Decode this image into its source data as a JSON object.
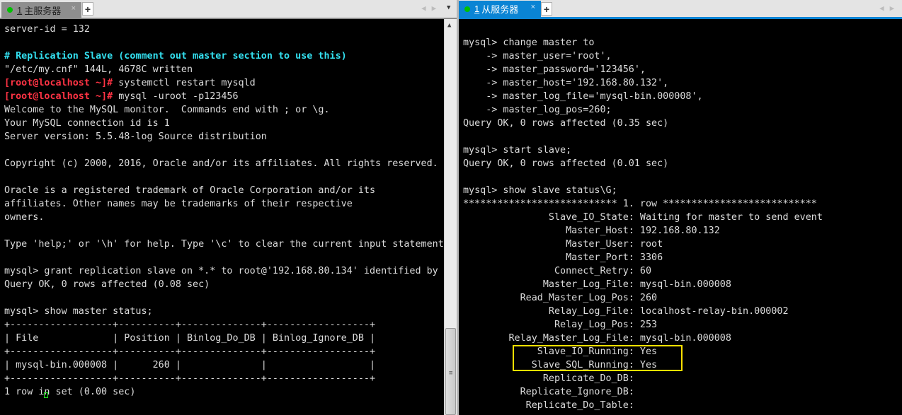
{
  "left": {
    "tab": {
      "number": "1",
      "title": "主服务器",
      "status": "connected"
    },
    "lines": [
      [
        {
          "t": "server-id = 132"
        }
      ],
      [
        {
          "t": ""
        }
      ],
      [
        {
          "t": "# Replication Slave (comment out master section to use this)",
          "c": "cyan"
        }
      ],
      [
        {
          "t": "\"/etc/my.cnf\" 144L, 4678C written"
        }
      ],
      [
        {
          "t": "[root@localhost ~]#",
          "c": "red"
        },
        {
          "t": " systemctl restart mysqld"
        }
      ],
      [
        {
          "t": "[root@localhost ~]#",
          "c": "red"
        },
        {
          "t": " mysql -uroot -p123456"
        }
      ],
      [
        {
          "t": "Welcome to the MySQL monitor.  Commands end with ; or \\g."
        }
      ],
      [
        {
          "t": "Your MySQL connection id is 1"
        }
      ],
      [
        {
          "t": "Server version: 5.5.48-log Source distribution"
        }
      ],
      [
        {
          "t": ""
        }
      ],
      [
        {
          "t": "Copyright (c) 2000, 2016, Oracle and/or its affiliates. All rights reserved."
        }
      ],
      [
        {
          "t": ""
        }
      ],
      [
        {
          "t": "Oracle is a registered trademark of Oracle Corporation and/or its"
        }
      ],
      [
        {
          "t": "affiliates. Other names may be trademarks of their respective"
        }
      ],
      [
        {
          "t": "owners."
        }
      ],
      [
        {
          "t": ""
        }
      ],
      [
        {
          "t": "Type 'help;' or '\\h' for help. Type '\\c' to clear the current input statement"
        }
      ],
      [
        {
          "t": ""
        }
      ],
      [
        {
          "t": "mysql> grant replication slave on *.* to root@'192.168.80.134' identified by"
        }
      ],
      [
        {
          "t": "Query OK, 0 rows affected (0.08 sec)"
        }
      ],
      [
        {
          "t": ""
        }
      ],
      [
        {
          "t": "mysql> show master status;"
        }
      ],
      [
        {
          "t": "+------------------+----------+--------------+------------------+"
        }
      ],
      [
        {
          "t": "| File             | Position | Binlog_Do_DB | Binlog_Ignore_DB |"
        }
      ],
      [
        {
          "t": "+------------------+----------+--------------+------------------+"
        }
      ],
      [
        {
          "t": "| mysql-bin.000008 |      260 |              |                  |"
        }
      ],
      [
        {
          "t": "+------------------+----------+--------------+------------------+"
        }
      ],
      [
        {
          "t": "1 row in set (0.00 sec)"
        }
      ]
    ],
    "master_status_table": {
      "columns": [
        "File",
        "Position",
        "Binlog_Do_DB",
        "Binlog_Ignore_DB"
      ],
      "rows": [
        [
          "mysql-bin.000008",
          "260",
          "",
          ""
        ]
      ]
    }
  },
  "right": {
    "tab": {
      "number": "1",
      "title": "从服务器",
      "status": "connected"
    },
    "lines": [
      [
        {
          "t": "mysql> change master to"
        }
      ],
      [
        {
          "t": "    -> master_user='root',"
        }
      ],
      [
        {
          "t": "    -> master_password='123456',"
        }
      ],
      [
        {
          "t": "    -> master_host='192.168.80.132',"
        }
      ],
      [
        {
          "t": "    -> master_log_file='mysql-bin.000008',"
        }
      ],
      [
        {
          "t": "    -> master_log_pos=260;"
        }
      ],
      [
        {
          "t": "Query OK, 0 rows affected (0.35 sec)"
        }
      ],
      [
        {
          "t": ""
        }
      ],
      [
        {
          "t": "mysql> start slave;"
        }
      ],
      [
        {
          "t": "Query OK, 0 rows affected (0.01 sec)"
        }
      ],
      [
        {
          "t": ""
        }
      ],
      [
        {
          "t": "mysql> show slave status\\G;"
        }
      ],
      [
        {
          "t": "*************************** 1. row ***************************"
        }
      ],
      [
        {
          "t": "               Slave_IO_State: Waiting for master to send event"
        }
      ],
      [
        {
          "t": "                  Master_Host: 192.168.80.132"
        }
      ],
      [
        {
          "t": "                  Master_User: root"
        }
      ],
      [
        {
          "t": "                  Master_Port: 3306"
        }
      ],
      [
        {
          "t": "                Connect_Retry: 60"
        }
      ],
      [
        {
          "t": "              Master_Log_File: mysql-bin.000008"
        }
      ],
      [
        {
          "t": "          Read_Master_Log_Pos: 260"
        }
      ],
      [
        {
          "t": "               Relay_Log_File: localhost-relay-bin.000002"
        }
      ],
      [
        {
          "t": "                Relay_Log_Pos: 253"
        }
      ],
      [
        {
          "t": "        Relay_Master_Log_File: mysql-bin.000008"
        }
      ],
      [
        {
          "t": "             Slave_IO_Running: Yes"
        }
      ],
      [
        {
          "t": "            Slave_SQL_Running: Yes"
        }
      ],
      [
        {
          "t": "              Replicate_Do_DB: "
        }
      ],
      [
        {
          "t": "          Replicate_Ignore_DB: "
        }
      ],
      [
        {
          "t": "           Replicate_Do_Table: "
        }
      ]
    ],
    "highlighted_fields": [
      "Slave_IO_Running: Yes",
      "Slave_SQL_Running: Yes"
    ],
    "highlight_color": "#ffe000"
  },
  "ui": {
    "tab_close_glyph": "×",
    "new_tab_glyph": "+",
    "nav_prev_glyph": "◀",
    "nav_next_glyph": "▶",
    "dropdown_glyph": "▼",
    "scroll_up_glyph": "▲",
    "scroll_grip_glyph": "≡"
  },
  "colors": {
    "terminal_bg": "#000000",
    "terminal_fg": "#dcdcdc",
    "comment_cyan": "#33e0f0",
    "prompt_red": "#ff3344",
    "active_tab_blue": "#0a84d4",
    "status_green": "#00c000"
  }
}
